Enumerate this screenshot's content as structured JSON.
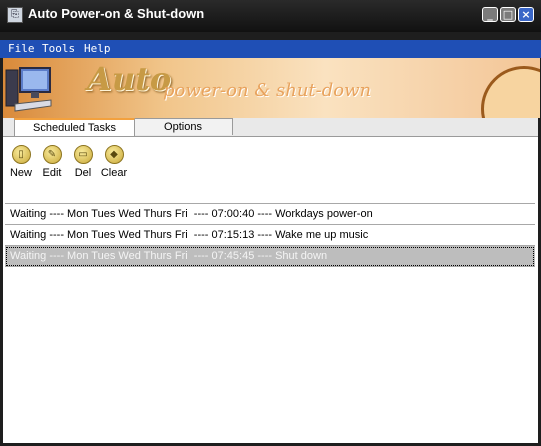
{
  "window": {
    "title": "Auto Power-on & Shut-down",
    "icon": "app-icon",
    "controls": {
      "minimize": "_",
      "maximize": "□",
      "close": "×"
    }
  },
  "menubar": {
    "items": [
      "File",
      "Tools",
      "Help"
    ]
  },
  "banner": {
    "title": "Auto",
    "subtitle": "power-on & shut-down"
  },
  "tabs": [
    {
      "label": "Scheduled Tasks",
      "active": true
    },
    {
      "label": "Options",
      "active": false
    }
  ],
  "toolbar": {
    "new_label": "New",
    "edit_label": "Edit",
    "del_label": "Del",
    "clear_label": "Clear"
  },
  "tasks": [
    {
      "text": "Waiting ---- Mon Tues Wed Thurs Fri  ---- 07:00:40 ---- Workdays power-on",
      "selected": false
    },
    {
      "text": "Waiting ---- Mon Tues Wed Thurs Fri  ---- 07:15:13 ---- Wake me up music",
      "selected": false
    },
    {
      "text": "Waiting ---- Mon Tues Wed Thurs Fri  ---- 07:45:45 ---- Shut down",
      "selected": true
    }
  ],
  "colors": {
    "menubar": "#1f4fb5",
    "close_button": "#3a66c7",
    "selected_row": "#bdbdbd",
    "active_tab_accent": "#f3a13e"
  }
}
